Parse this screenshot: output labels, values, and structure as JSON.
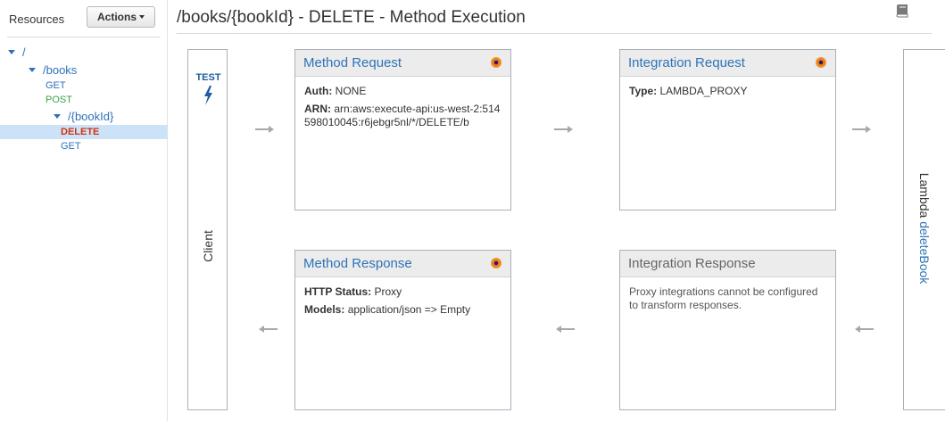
{
  "sidebar": {
    "title": "Resources",
    "actions_label": "Actions",
    "tree": {
      "root": "/",
      "books": "/books",
      "books_get": "GET",
      "books_post": "POST",
      "bookid": "/{bookId}",
      "bookid_delete": "DELETE",
      "bookid_get": "GET"
    }
  },
  "page": {
    "title": "/books/{bookId} - DELETE - Method Execution"
  },
  "client": {
    "test_label": "TEST",
    "label": "Client"
  },
  "lambda": {
    "prefix": "Lambda ",
    "function_name": "deleteBook"
  },
  "method_request": {
    "title": "Method Request",
    "auth_label": "Auth:",
    "auth_value": "NONE",
    "arn_label": "ARN:",
    "arn_value": "arn:aws:execute-api:us-west-2:514598010045:r6jebgr5nl/*/DELETE/b"
  },
  "integration_request": {
    "title": "Integration Request",
    "type_label": "Type:",
    "type_value": "LAMBDA_PROXY"
  },
  "method_response": {
    "title": "Method Response",
    "status_label": "HTTP Status:",
    "status_value": "Proxy",
    "models_label": "Models:",
    "models_value": "application/json => Empty"
  },
  "integration_response": {
    "title": "Integration Response",
    "note": "Proxy integrations cannot be configured to transform responses."
  },
  "colors": {
    "link_blue": "#2e73b8",
    "post_green": "#3aa349",
    "delete_red": "#d13212",
    "selected_bg": "#cce3f7"
  }
}
